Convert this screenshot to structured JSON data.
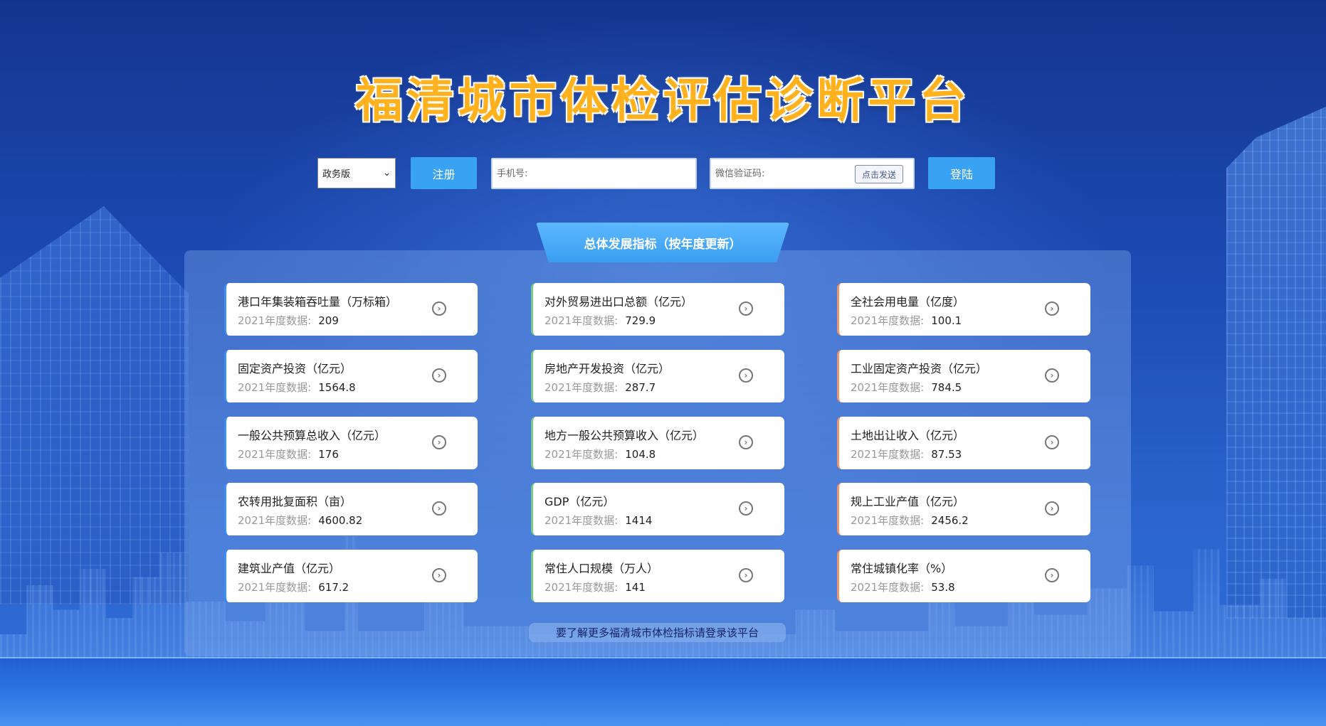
{
  "title": "福清城市体检评估诊断平台",
  "login": {
    "edition_select": "政务版",
    "register_label": "注册",
    "phone_placeholder": "手机号:",
    "code_placeholder": "微信验证码:",
    "send_label": "点击发送",
    "login_label": "登陆"
  },
  "panel": {
    "title": "总体发展指标（按年度更新）",
    "year_label": "2021年度数据:",
    "indicators": [
      {
        "label": "港口年集装箱吞吐量（万标箱）",
        "value": "209"
      },
      {
        "label": "对外贸易进出口总额（亿元）",
        "value": "729.9"
      },
      {
        "label": "全社会用电量（亿度）",
        "value": "100.1"
      },
      {
        "label": "固定资产投资（亿元）",
        "value": "1564.8"
      },
      {
        "label": "房地产开发投资（亿元）",
        "value": "287.7"
      },
      {
        "label": "工业固定资产投资（亿元）",
        "value": "784.5"
      },
      {
        "label": "一般公共预算总收入（亿元）",
        "value": "176"
      },
      {
        "label": "地方一般公共预算收入（亿元）",
        "value": "104.8"
      },
      {
        "label": "土地出让收入（亿元）",
        "value": "87.53"
      },
      {
        "label": "农转用批复面积（亩）",
        "value": "4600.82"
      },
      {
        "label": "GDP（亿元）",
        "value": "1414"
      },
      {
        "label": "规上工业产值（亿元）",
        "value": "2456.2"
      },
      {
        "label": "建筑业产值（亿元）",
        "value": "617.2"
      },
      {
        "label": "常住人口规模（万人）",
        "value": "141"
      },
      {
        "label": "常住城镇化率（%）",
        "value": "53.8"
      }
    ],
    "footer_note": "要了解更多福清城市体检指标请登录该平台"
  },
  "colors": {
    "title": "#ffb21e",
    "button": "#3aa2f2",
    "col0_accent": "#3c8ef0",
    "col1_accent": "#79c98a",
    "col2_accent": "#f0946a"
  },
  "icons": {
    "select_arrow": "chevron-down-icon",
    "card_action": "chevron-right-circle-icon"
  }
}
